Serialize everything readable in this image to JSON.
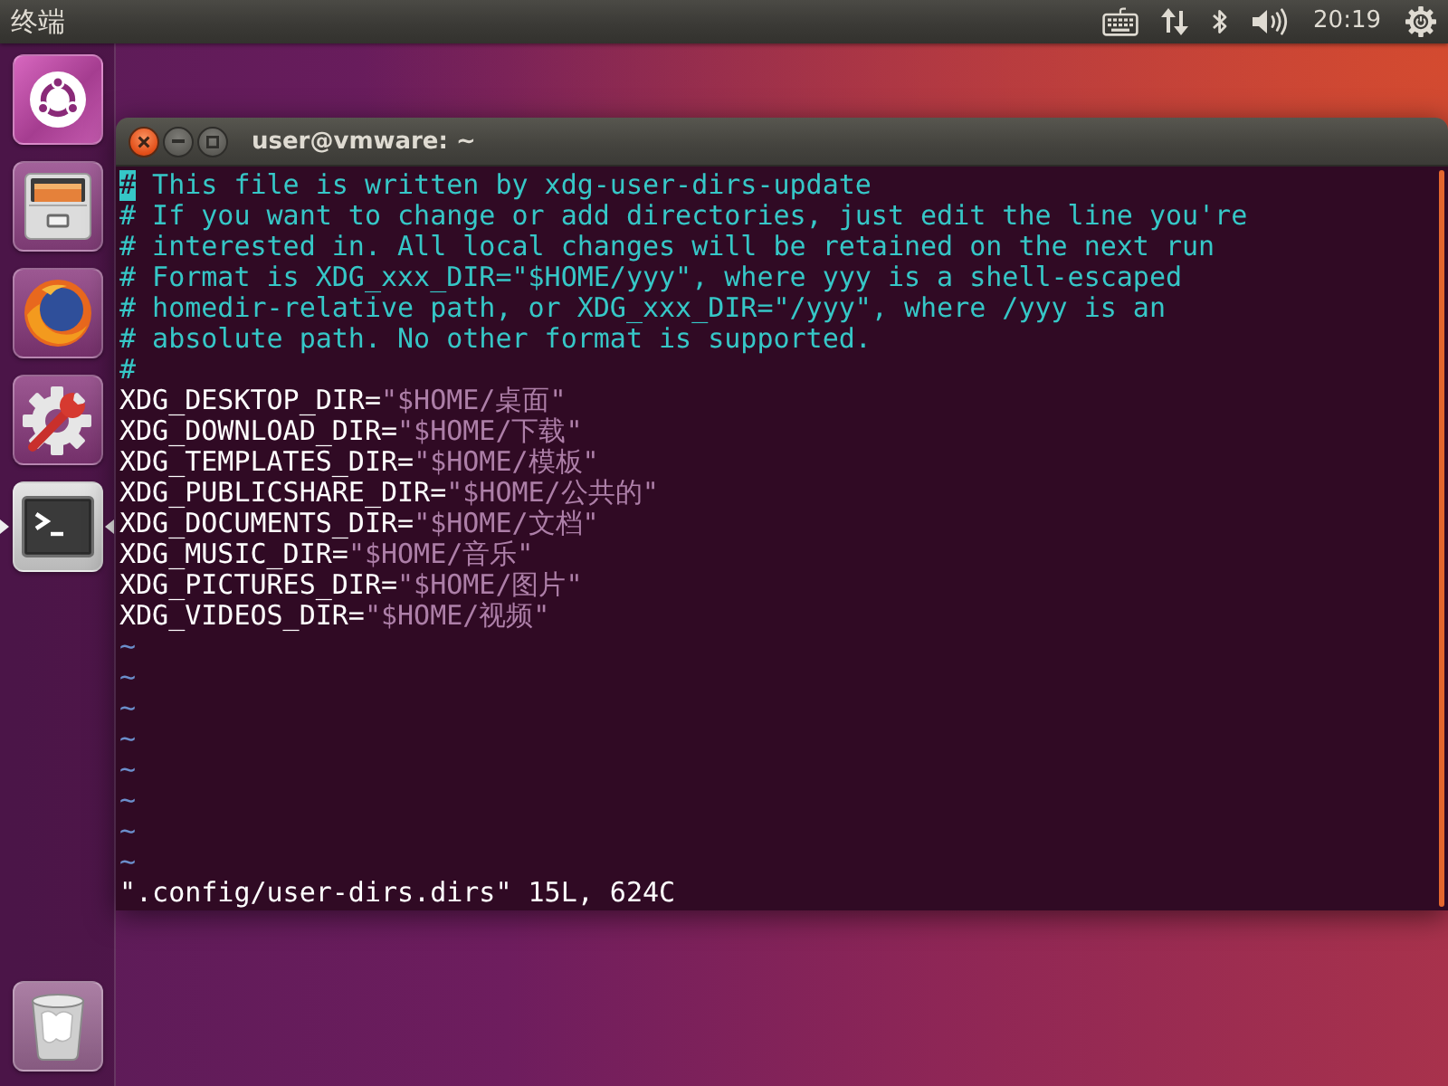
{
  "top_panel": {
    "app_title": "终端",
    "clock": "20:19"
  },
  "launcher": {
    "items": [
      {
        "kind": "dash",
        "running": false,
        "focused": false
      },
      {
        "kind": "files",
        "running": false,
        "focused": false
      },
      {
        "kind": "browser",
        "running": false,
        "focused": false
      },
      {
        "kind": "settings",
        "running": false,
        "focused": false
      },
      {
        "kind": "terminal",
        "running": true,
        "focused": true
      },
      {
        "kind": "trash",
        "running": false,
        "focused": false
      }
    ]
  },
  "terminal_window": {
    "title": "user@vmware: ~",
    "lines": [
      {
        "kind": "comment",
        "text": "# This file is written by xdg-user-dirs-update",
        "cursor": true
      },
      {
        "kind": "comment",
        "text": "# If you want to change or add directories, just edit the line you're",
        "cursor": false
      },
      {
        "kind": "comment",
        "text": "# interested in. All local changes will be retained on the next run",
        "cursor": false
      },
      {
        "kind": "comment",
        "text": "# Format is XDG_xxx_DIR=\"$HOME/yyy\", where yyy is a shell-escaped",
        "cursor": false
      },
      {
        "kind": "comment",
        "text": "# homedir-relative path, or XDG_xxx_DIR=\"/yyy\", where /yyy is an",
        "cursor": false
      },
      {
        "kind": "comment",
        "text": "# absolute path. No other format is supported.",
        "cursor": false
      },
      {
        "kind": "comment",
        "text": "#",
        "cursor": false
      },
      {
        "kind": "assignment",
        "key": "XDG_DESKTOP_DIR=",
        "value": "\"$HOME/桌面\"",
        "cursor": false
      },
      {
        "kind": "assignment",
        "key": "XDG_DOWNLOAD_DIR=",
        "value": "\"$HOME/下载\"",
        "cursor": false
      },
      {
        "kind": "assignment",
        "key": "XDG_TEMPLATES_DIR=",
        "value": "\"$HOME/模板\"",
        "cursor": false
      },
      {
        "kind": "assignment",
        "key": "XDG_PUBLICSHARE_DIR=",
        "value": "\"$HOME/公共的\"",
        "cursor": false
      },
      {
        "kind": "assignment",
        "key": "XDG_DOCUMENTS_DIR=",
        "value": "\"$HOME/文档\"",
        "cursor": false
      },
      {
        "kind": "assignment",
        "key": "XDG_MUSIC_DIR=",
        "value": "\"$HOME/音乐\"",
        "cursor": false
      },
      {
        "kind": "assignment",
        "key": "XDG_PICTURES_DIR=",
        "value": "\"$HOME/图片\"",
        "cursor": false
      },
      {
        "kind": "assignment",
        "key": "XDG_VIDEOS_DIR=",
        "value": "\"$HOME/视频\"",
        "cursor": false
      },
      {
        "kind": "filler",
        "text": "~",
        "cursor": false
      },
      {
        "kind": "filler",
        "text": "~",
        "cursor": false
      },
      {
        "kind": "filler",
        "text": "~",
        "cursor": false
      },
      {
        "kind": "filler",
        "text": "~",
        "cursor": false
      },
      {
        "kind": "filler",
        "text": "~",
        "cursor": false
      },
      {
        "kind": "filler",
        "text": "~",
        "cursor": false
      },
      {
        "kind": "filler",
        "text": "~",
        "cursor": false
      },
      {
        "kind": "filler",
        "text": "~",
        "cursor": false
      }
    ],
    "status_line": "\".config/user-dirs.dirs\" 15L, 624C"
  }
}
